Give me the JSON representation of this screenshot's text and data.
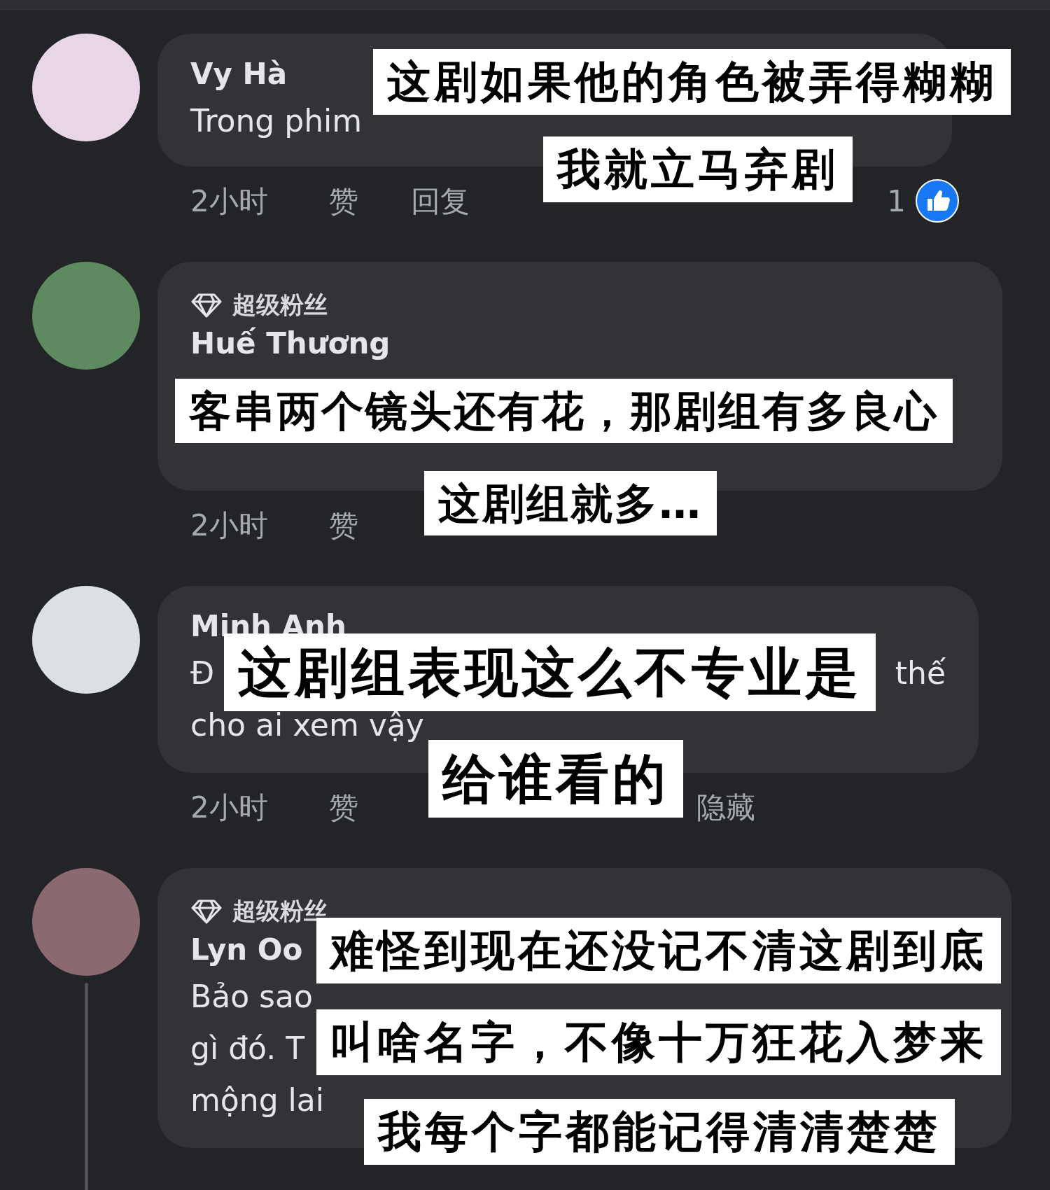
{
  "comments": [
    {
      "author": "Vy Hà",
      "body_lines": [
        [
          "Trong phim"
        ]
      ],
      "actions": [
        {
          "kind": "time",
          "text": "2小时"
        },
        {
          "kind": "like",
          "text": "赞"
        },
        {
          "kind": "reply",
          "text": "回复"
        }
      ],
      "likes": "1",
      "captions": [
        "这剧如果他的角色被弄得糊糊",
        "我就立马弃剧"
      ]
    },
    {
      "badge": "超级粉丝",
      "author": "Huế Thương",
      "actions": [
        {
          "kind": "time",
          "text": "2小时"
        },
        {
          "kind": "like",
          "text": "赞"
        }
      ],
      "captions": [
        "客串两个镜头还有花，那剧组有多良心",
        "这剧组就多…"
      ]
    },
    {
      "author": "Minh Anh",
      "body_lines": [
        [
          "Đ",
          "thế"
        ],
        [
          "cho ai xem vậy"
        ]
      ],
      "actions": [
        {
          "kind": "time",
          "text": "2小时"
        },
        {
          "kind": "like",
          "text": "赞"
        },
        {
          "kind": "hide",
          "text": "隐藏"
        }
      ],
      "captions": [
        "这剧组表现这么不专业是",
        "给谁看的"
      ]
    },
    {
      "badge": "超级粉丝",
      "author": "Lyn Oo",
      "body_lines": [
        [
          "Bảo sao"
        ],
        [
          "gì đó. T"
        ],
        [
          "mộng lai"
        ]
      ],
      "captions": [
        "难怪到现在还没记不清这剧到底",
        "叫啥名字，不像十万狂花入梦来",
        "我每个字都能记得清清楚楚"
      ]
    }
  ]
}
